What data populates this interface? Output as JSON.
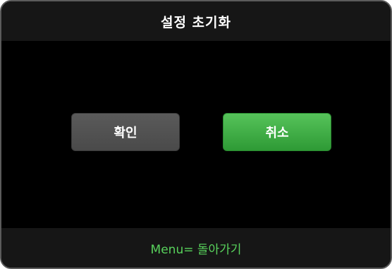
{
  "dialog": {
    "title": "설정 초기화",
    "buttons": {
      "confirm_label": "확인",
      "cancel_label": "취소"
    },
    "footer_hint": "Menu= 돌아가기"
  },
  "colors": {
    "background": "#000000",
    "bar": "#161616",
    "confirm_button": "#4f4f4f",
    "cancel_button": "#3fae45",
    "hint_text": "#58d25c"
  }
}
